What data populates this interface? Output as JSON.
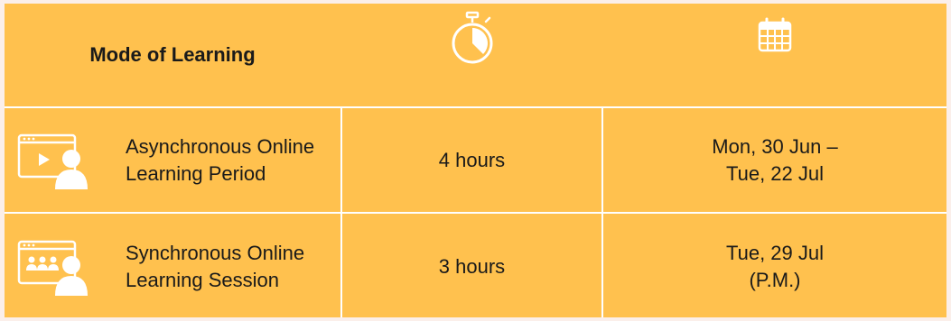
{
  "header": {
    "mode_label": "Mode of Learning",
    "duration_icon": "stopwatch-icon",
    "date_icon": "calendar-icon"
  },
  "rows": [
    {
      "icon": "video-learner-icon",
      "mode_line1": "Asynchronous Online",
      "mode_line2": "Learning Period",
      "duration": "4 hours",
      "date_line1": "Mon, 30 Jun –",
      "date_line2": "Tue, 22 Jul"
    },
    {
      "icon": "group-session-learner-icon",
      "mode_line1": "Synchronous Online",
      "mode_line2": "Learning Session",
      "duration": "3 hours",
      "date_line1": "Tue, 29 Jul",
      "date_line2": "(P.M.)"
    }
  ],
  "colors": {
    "table_background": "#FFC14E",
    "page_background": "#FBEFEA",
    "icon_color": "#ffffff"
  }
}
